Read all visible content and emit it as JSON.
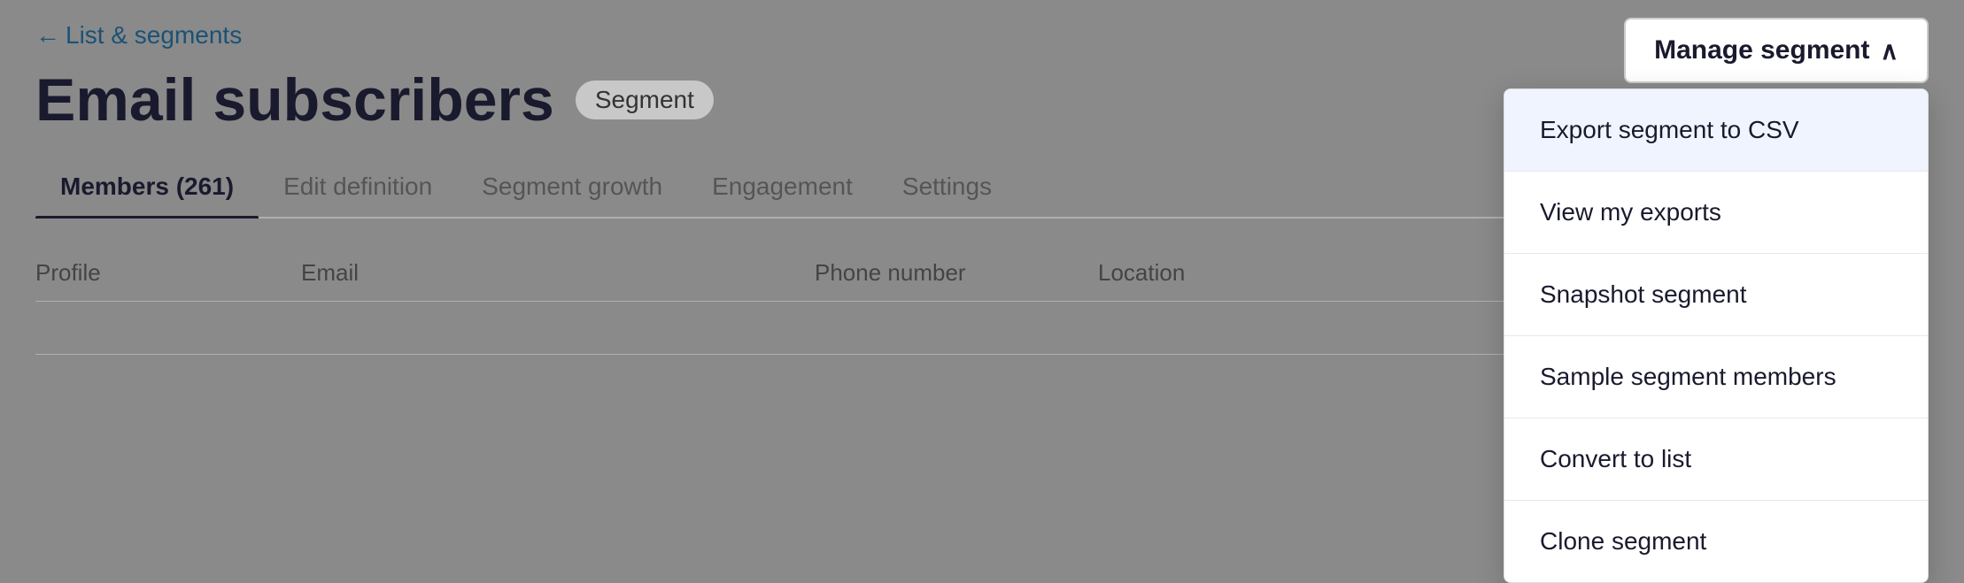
{
  "back_link": {
    "label": "List & segments"
  },
  "page": {
    "title": "Email subscribers",
    "badge": "Segment"
  },
  "tabs": [
    {
      "label": "Members (261)",
      "active": true
    },
    {
      "label": "Edit definition",
      "active": false
    },
    {
      "label": "Segment growth",
      "active": false
    },
    {
      "label": "Engagement",
      "active": false
    },
    {
      "label": "Settings",
      "active": false
    }
  ],
  "table": {
    "columns": [
      "Profile",
      "Email",
      "Phone number",
      "Location"
    ]
  },
  "manage_segment": {
    "button_label": "Manage segment",
    "chevron": "∧",
    "menu_items": [
      {
        "label": "Export segment to CSV",
        "highlighted": true
      },
      {
        "label": "View my exports",
        "highlighted": false
      },
      {
        "label": "Snapshot segment",
        "highlighted": false
      },
      {
        "label": "Sample segment members",
        "highlighted": false
      },
      {
        "label": "Convert to list",
        "highlighted": false
      },
      {
        "label": "Clone segment",
        "highlighted": false
      }
    ]
  }
}
